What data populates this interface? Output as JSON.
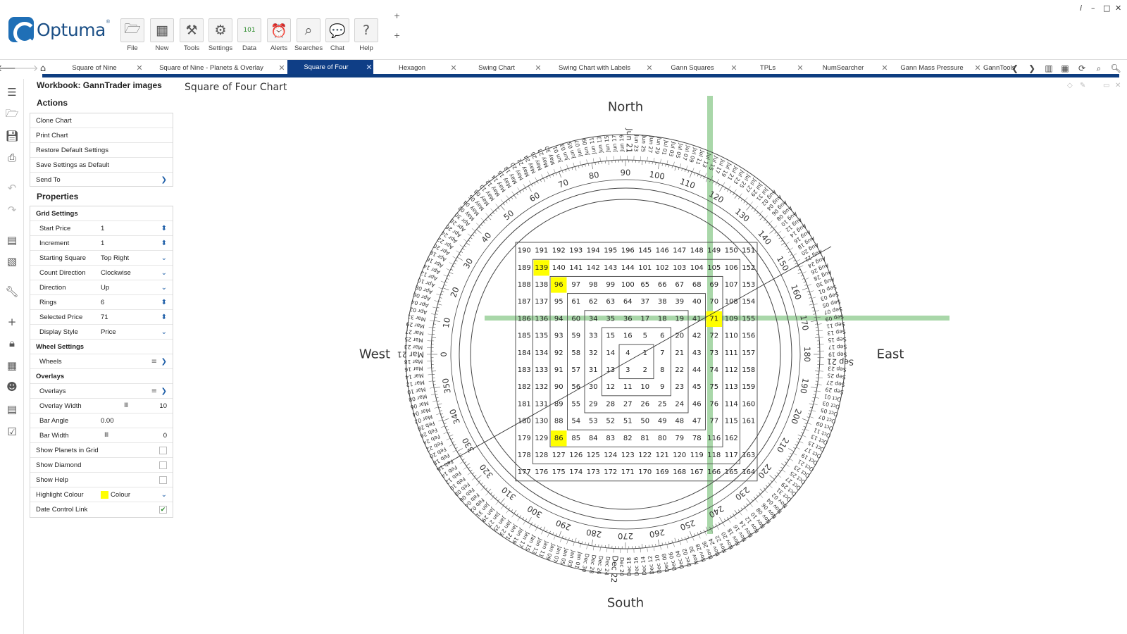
{
  "app": {
    "logo_text": "Optuma",
    "window_controls": [
      "i",
      "–",
      "□",
      "✕"
    ],
    "ribbon": [
      {
        "name": "file",
        "label": "File",
        "icon": "folder-icon",
        "glyph": "🗁"
      },
      {
        "name": "new",
        "label": "New",
        "icon": "new-chart-icon",
        "glyph": "▦"
      },
      {
        "name": "tools",
        "label": "Tools",
        "icon": "tools-icon",
        "glyph": "⚒"
      },
      {
        "name": "settings",
        "label": "Settings",
        "icon": "gear-icon",
        "glyph": "⚙"
      },
      {
        "name": "data",
        "label": "Data",
        "icon": "binary-data-icon",
        "glyph": "101"
      },
      {
        "name": "alerts",
        "label": "Alerts",
        "icon": "alarm-clock-icon",
        "glyph": "⏰"
      },
      {
        "name": "searches",
        "label": "Searches",
        "icon": "magnifier-icon",
        "glyph": "⌕"
      },
      {
        "name": "chat",
        "label": "Chat",
        "icon": "chat-bubbles-icon",
        "glyph": "💬"
      },
      {
        "name": "help",
        "label": "Help",
        "icon": "question-mark-icon",
        "glyph": "?"
      }
    ],
    "plus_buttons": [
      "+",
      "+"
    ]
  },
  "tabs": [
    {
      "label": "Square of Nine",
      "active": false
    },
    {
      "label": "Square of Nine - Planets & Overlay",
      "active": false
    },
    {
      "label": "Square of Four",
      "active": true
    },
    {
      "label": "Hexagon",
      "active": false
    },
    {
      "label": "Swing Chart",
      "active": false
    },
    {
      "label": "Swing Chart with Labels",
      "active": false
    },
    {
      "label": "Gann Squares",
      "active": false
    },
    {
      "label": "TPLs",
      "active": false
    },
    {
      "label": "NumSearcher",
      "active": false
    },
    {
      "label": "Gann Mass Pressure",
      "active": false
    },
    {
      "label": "GannTools",
      "active": false
    }
  ],
  "panel": {
    "workbook_title": "Workbook: GannTrader images",
    "actions_title": "Actions",
    "actions": [
      "Clone Chart",
      "Print Chart",
      "Restore Default Settings",
      "Save Settings as Default",
      "Send To"
    ],
    "properties_title": "Properties",
    "grid_settings": {
      "title": "Grid Settings",
      "rows": [
        {
          "label": "Start Price",
          "value": "1",
          "control": "spin"
        },
        {
          "label": "Increment",
          "value": "1",
          "control": "spin"
        },
        {
          "label": "Starting Square",
          "value": "Top Right",
          "control": "drop"
        },
        {
          "label": "Count Direction",
          "value": "Clockwise",
          "control": "drop"
        },
        {
          "label": "Direction",
          "value": "Up",
          "control": "drop"
        },
        {
          "label": "Rings",
          "value": "6",
          "control": "spin"
        },
        {
          "label": "Selected Price",
          "value": "71",
          "control": "spin"
        },
        {
          "label": "Display Style",
          "value": "Price",
          "control": "drop"
        }
      ]
    },
    "wheel_settings": {
      "title": "Wheel Settings",
      "wheels_label": "Wheels"
    },
    "overlays": {
      "title": "Overlays",
      "overlays_label": "Overlays",
      "overlay_width_label": "Overlay Width",
      "overlay_width": "10",
      "bar_angle_label": "Bar Angle",
      "bar_angle": "0.00",
      "bar_width_label": "Bar Width",
      "bar_width": "0"
    },
    "checks": [
      {
        "label": "Show Planets in Grid",
        "checked": false
      },
      {
        "label": "Show Diamond",
        "checked": false
      },
      {
        "label": "Show Help",
        "checked": false
      }
    ],
    "highlight_colour_label": "Highlight Colour",
    "highlight_colour_value": "Colour",
    "highlight_colour": "#ffff00",
    "date_control_link_label": "Date Control Link",
    "date_control_link": true
  },
  "chart": {
    "title": "Square of Four Chart",
    "directions": {
      "north": "North",
      "south": "South",
      "east": "East",
      "west": "West"
    },
    "grid_rows": [
      [
        190,
        191,
        192,
        193,
        194,
        195,
        196,
        145,
        146,
        147,
        148,
        149,
        150,
        151
      ],
      [
        189,
        139,
        140,
        141,
        142,
        143,
        144,
        101,
        102,
        103,
        104,
        105,
        106,
        152
      ],
      [
        188,
        138,
        96,
        97,
        98,
        99,
        100,
        65,
        66,
        67,
        68,
        69,
        107,
        153
      ],
      [
        187,
        137,
        95,
        61,
        62,
        63,
        64,
        37,
        38,
        39,
        40,
        70,
        108,
        154
      ],
      [
        186,
        136,
        94,
        60,
        34,
        35,
        36,
        17,
        18,
        19,
        41,
        71,
        109,
        155
      ],
      [
        185,
        135,
        93,
        59,
        33,
        15,
        16,
        5,
        6,
        20,
        42,
        72,
        110,
        156
      ],
      [
        184,
        134,
        92,
        58,
        32,
        14,
        4,
        1,
        7,
        21,
        43,
        73,
        111,
        157
      ],
      [
        183,
        133,
        91,
        57,
        31,
        13,
        3,
        2,
        8,
        22,
        44,
        74,
        112,
        158
      ],
      [
        182,
        132,
        90,
        56,
        30,
        12,
        11,
        10,
        9,
        23,
        45,
        75,
        113,
        159
      ],
      [
        181,
        131,
        89,
        55,
        29,
        28,
        27,
        26,
        25,
        24,
        46,
        76,
        114,
        160
      ],
      [
        180,
        130,
        88,
        54,
        53,
        52,
        51,
        50,
        49,
        48,
        47,
        77,
        115,
        161
      ],
      [
        179,
        129,
        86,
        85,
        84,
        83,
        82,
        81,
        80,
        79,
        78,
        116,
        162,
        0
      ],
      [
        178,
        128,
        127,
        126,
        125,
        124,
        123,
        122,
        121,
        120,
        119,
        118,
        117,
        163
      ],
      [
        177,
        176,
        175,
        174,
        173,
        172,
        171,
        170,
        169,
        168,
        167,
        166,
        165,
        164
      ]
    ],
    "highlighted": [
      139,
      96,
      71,
      86
    ],
    "highlight_color": "#ffff00",
    "overlay_color": "#8cc98c",
    "selected_price": 71,
    "degree_labels": [
      "0",
      "10",
      "20",
      "30",
      "40",
      "50",
      "60",
      "70",
      "80",
      "90",
      "100",
      "110",
      "120",
      "130",
      "140",
      "150",
      "160",
      "170",
      "180",
      "190",
      "200",
      "210",
      "220",
      "230",
      "240",
      "250",
      "260",
      "270",
      "280",
      "290",
      "300",
      "310",
      "320",
      "330",
      "340",
      "350"
    ],
    "cardinal_dates": {
      "top": "Jun 21",
      "right": "Sep 23",
      "bottom": "Dec 22",
      "left": "Mar 21"
    },
    "date_labels": [
      "Mar 21",
      "Mar 23",
      "Mar 25",
      "Mar 27",
      "Mar 29",
      "Mar 31",
      "Apr 02",
      "Apr 04",
      "Apr 06",
      "Apr 08",
      "Apr 10",
      "Apr 12",
      "Apr 14",
      "Apr 16",
      "Apr 18",
      "Apr 20",
      "Apr 22",
      "Apr 24",
      "Apr 26",
      "Apr 28",
      "Apr 30",
      "May 02",
      "May 04",
      "May 06",
      "May 08",
      "May 10",
      "May 12",
      "May 14",
      "May 16",
      "May 18",
      "May 20",
      "May 22",
      "May 24",
      "May 26",
      "May 28",
      "May 30",
      "Jun 01",
      "Jun 03",
      "Jun 05",
      "Jun 07",
      "Jun 09",
      "Jun 11",
      "Jun 13",
      "Jun 15",
      "Jun 17",
      "Jun 19",
      "Jun 21",
      "Jun 23",
      "Jun 25",
      "Jun 27",
      "Jun 29",
      "Jul 01",
      "Jul 03",
      "Jul 05",
      "Jul 07",
      "Jul 09",
      "Jul 11",
      "Jul 13",
      "Jul 15",
      "Jul 17",
      "Jul 19",
      "Jul 21",
      "Jul 23",
      "Jul 25",
      "Jul 27",
      "Jul 29",
      "Jul 31",
      "Aug 02",
      "Aug 04",
      "Aug 06",
      "Aug 08",
      "Aug 10",
      "Aug 12",
      "Aug 14",
      "Aug 16",
      "Aug 18",
      "Aug 20",
      "Aug 22",
      "Aug 24",
      "Aug 26",
      "Aug 28",
      "Aug 30",
      "Sep 01",
      "Sep 03",
      "Sep 05",
      "Sep 07",
      "Sep 09",
      "Sep 11",
      "Sep 13",
      "Sep 15",
      "Sep 17",
      "Sep 19",
      "Sep 21",
      "Sep 23",
      "Sep 25",
      "Sep 27",
      "Sep 29",
      "Oct 01",
      "Oct 03",
      "Oct 05",
      "Oct 07",
      "Oct 09",
      "Oct 11",
      "Oct 13",
      "Oct 15",
      "Oct 17",
      "Oct 19",
      "Oct 21",
      "Oct 23",
      "Oct 25",
      "Oct 27",
      "Oct 29",
      "Oct 31",
      "Nov 02",
      "Nov 04",
      "Nov 06",
      "Nov 08",
      "Nov 10",
      "Nov 12",
      "Nov 14",
      "Nov 16",
      "Nov 18",
      "Nov 20",
      "Nov 22",
      "Nov 24",
      "Nov 26",
      "Nov 28",
      "Nov 30",
      "Dec 02",
      "Dec 04",
      "Dec 06",
      "Dec 08",
      "Dec 10",
      "Dec 12",
      "Dec 14",
      "Dec 16",
      "Dec 18",
      "Dec 20",
      "Dec 22",
      "Dec 24",
      "Dec 26",
      "Dec 28",
      "Dec 30",
      "Jan 01",
      "Jan 03",
      "Jan 05",
      "Jan 07",
      "Jan 09",
      "Jan 11",
      "Jan 13",
      "Jan 15",
      "Jan 17",
      "Jan 19",
      "Jan 21",
      "Jan 23",
      "Jan 25",
      "Jan 27",
      "Jan 29",
      "Jan 31",
      "Feb 02",
      "Feb 04",
      "Feb 06",
      "Feb 08",
      "Feb 10",
      "Feb 12",
      "Feb 14",
      "Feb 16",
      "Feb 18",
      "Feb 20",
      "Feb 22",
      "Feb 24",
      "Feb 26",
      "Feb 28",
      "Mar 02",
      "Mar 04",
      "Mar 06",
      "Mar 08",
      "Mar 10",
      "Mar 12",
      "Mar 14",
      "Mar 16",
      "Mar 18"
    ]
  }
}
